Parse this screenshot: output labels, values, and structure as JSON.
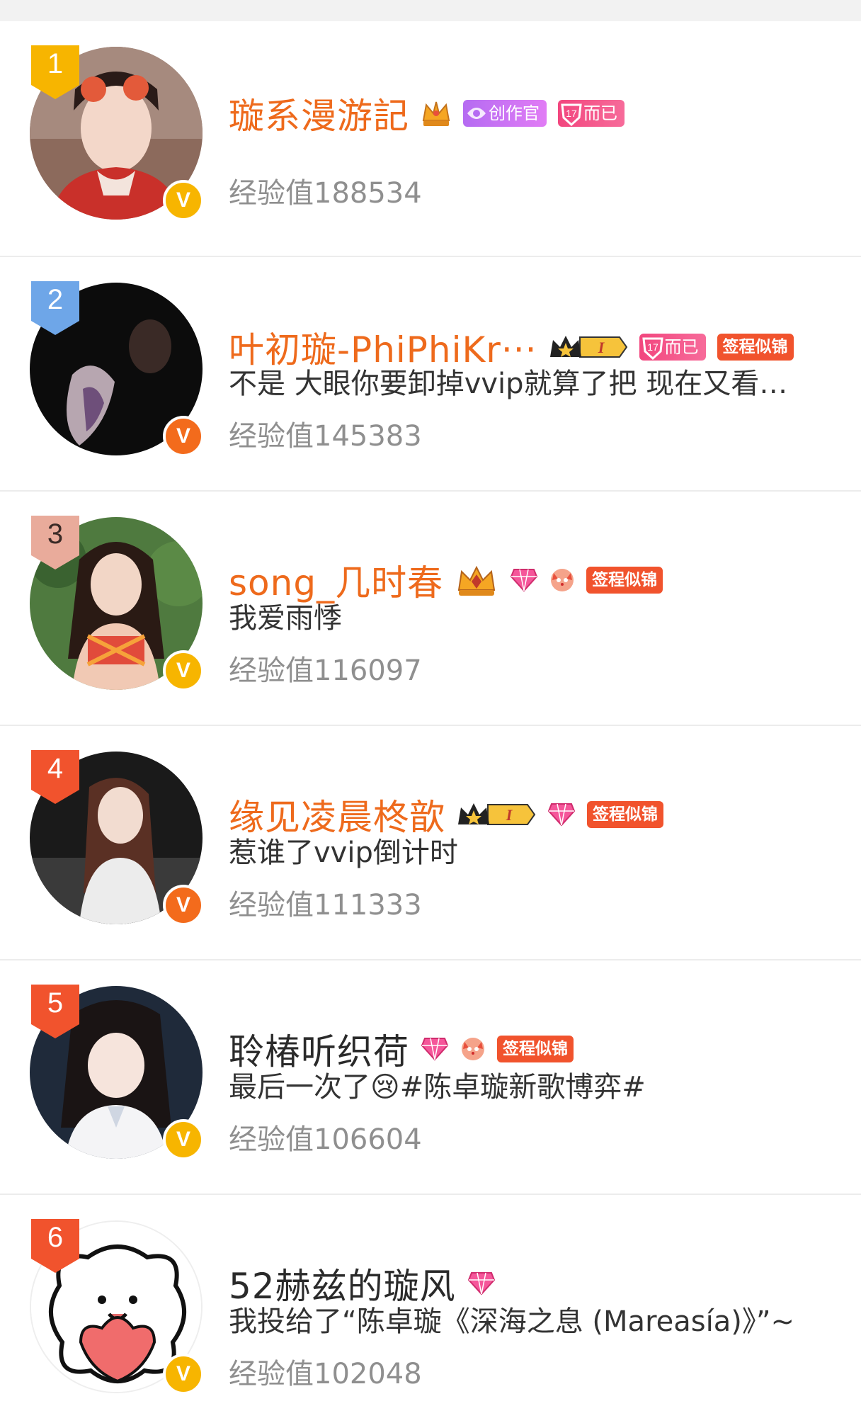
{
  "ranking": [
    {
      "rank": "1",
      "name": "璇系漫游記",
      "name_color": "orange",
      "desc": "",
      "exp": "经验值188534",
      "v_color": "yellow",
      "rank_color": "#f7b500",
      "badges": [
        "crown-badge",
        "creator-pill",
        "level17-pill"
      ],
      "creator_label": "创作官",
      "level_label": "而已",
      "level_num": "17"
    },
    {
      "rank": "2",
      "name": "叶初璇-PhiPhiKr···",
      "name_color": "orange",
      "desc": "不是 大眼你要卸掉vvip就算了把 现在又看…",
      "exp": "经验值145383",
      "v_color": "orange",
      "rank_color": "#6ea6e8",
      "badges": [
        "vip-crown-badge",
        "level17-pill",
        "sign-tag"
      ],
      "level_label": "而已",
      "level_num": "17",
      "sign_label": "签程似锦",
      "vip_level": "I"
    },
    {
      "rank": "3",
      "name": "song_几时春",
      "name_color": "orange",
      "desc": "我爱雨悸",
      "exp": "经验值116097",
      "v_color": "yellow",
      "rank_color": "#e9ab9b",
      "badges": [
        "crown-badge",
        "diamond-icon",
        "fox-icon",
        "sign-tag"
      ],
      "sign_label": "签程似锦"
    },
    {
      "rank": "4",
      "name": "缘见凌晨柊歆",
      "name_color": "orange",
      "desc": "惹谁了vvip倒计时",
      "exp": "经验值111333",
      "v_color": "orange",
      "rank_color": "#f1532d",
      "badges": [
        "vip-crown-badge",
        "diamond-icon",
        "sign-tag"
      ],
      "sign_label": "签程似锦",
      "vip_level": "I"
    },
    {
      "rank": "5",
      "name": "聆椿听织荷",
      "name_color": "black",
      "desc": "最后一次了😢#陈卓璇新歌博弈#",
      "exp": "经验值106604",
      "v_color": "yellow",
      "rank_color": "#f1532d",
      "badges": [
        "diamond-icon",
        "fox-icon",
        "sign-tag"
      ],
      "sign_label": "签程似锦"
    },
    {
      "rank": "6",
      "name": "52赫兹的璇风",
      "name_color": "black",
      "desc": "我投给了“陈卓璇《深海之息 (Mareasía)》”~",
      "exp": "经验值102048",
      "v_color": "yellow",
      "rank_color": "#f1532d",
      "badges": [
        "diamond-icon"
      ]
    }
  ],
  "colors": {
    "accent_orange": "#ee6a1c",
    "tag_red": "#f1532d",
    "v_yellow": "#f7b500",
    "v_orange": "#f36b1c"
  }
}
